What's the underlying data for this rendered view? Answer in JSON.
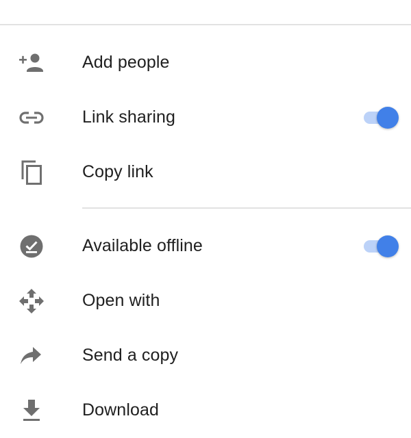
{
  "menu": {
    "items": [
      {
        "id": "add-people",
        "label": "Add people",
        "icon": "person-add-icon"
      },
      {
        "id": "link-sharing",
        "label": "Link sharing",
        "icon": "link-icon",
        "toggle": {
          "on": true
        }
      },
      {
        "id": "copy-link",
        "label": "Copy link",
        "icon": "copy-icon"
      },
      {
        "id": "available-offline",
        "label": "Available offline",
        "icon": "offline-pin-icon",
        "toggle": {
          "on": true
        }
      },
      {
        "id": "open-with",
        "label": "Open with",
        "icon": "open-with-icon"
      },
      {
        "id": "send-a-copy",
        "label": "Send a copy",
        "icon": "share-arrow-icon"
      },
      {
        "id": "download",
        "label": "Download",
        "icon": "download-icon"
      }
    ]
  },
  "colors": {
    "icon": "#6f6f6f",
    "toggle_thumb": "#4180e8",
    "toggle_track": "#bcd2f8",
    "divider": "#e2e2e2"
  }
}
